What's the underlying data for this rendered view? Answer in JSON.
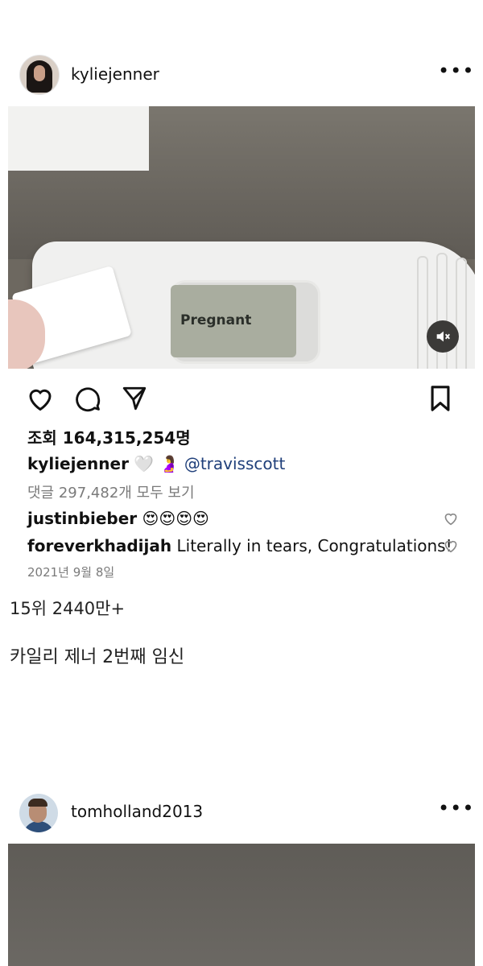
{
  "post1": {
    "username": "kyliejenner",
    "more_label": "•••",
    "photo_text": "Pregnant",
    "views": "조회 164,315,254명",
    "caption": {
      "username": "kyliejenner",
      "emoji": "🤍 🤰",
      "mention": "@travisscott"
    },
    "comments_link": "댓글 297,482개 모두 보기",
    "comments": [
      {
        "username": "justinbieber",
        "text": "😍😍😍😍"
      },
      {
        "username": "foreverkhadijah",
        "text": "Literally in tears, Congratulations!"
      }
    ],
    "date": "2021년 9월 8일"
  },
  "rank_text": "15위 2440만+",
  "description_text": "카일리 제너 2번째 임신",
  "post2": {
    "username": "tomholland2013",
    "more_label": "•••"
  },
  "icons": {
    "like": "heart-icon",
    "comment": "comment-icon",
    "share": "send-icon",
    "save": "bookmark-icon",
    "mute": "speaker-muted-icon"
  }
}
